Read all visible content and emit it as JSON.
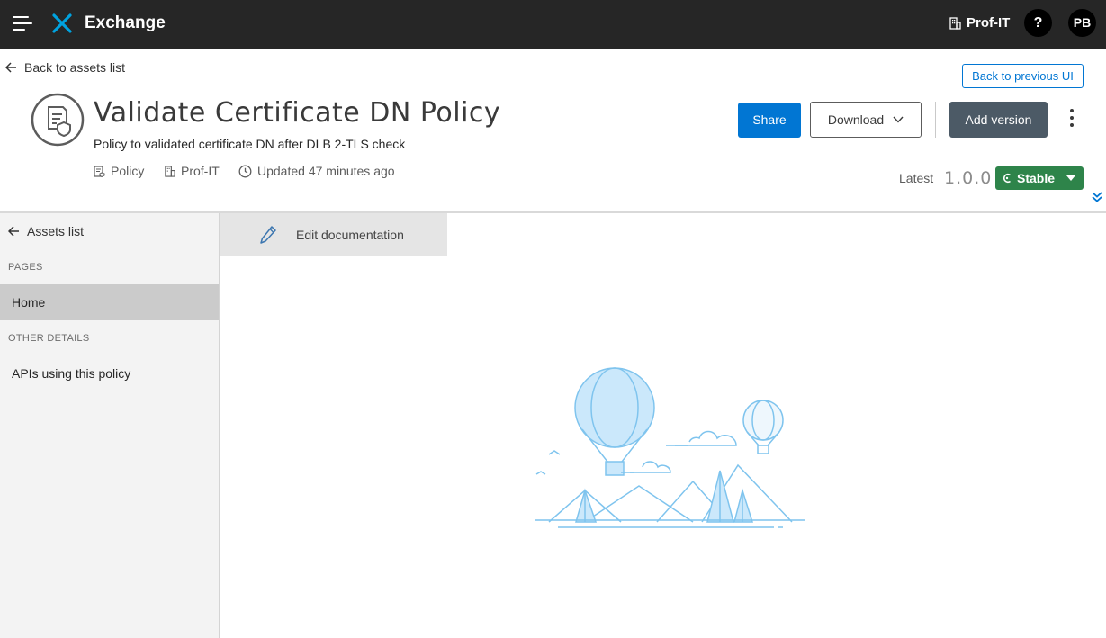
{
  "topbar": {
    "app_title": "Exchange",
    "org_name": "Prof-IT",
    "help_label": "?",
    "avatar_initials": "PB"
  },
  "header": {
    "back_link": "Back to assets list",
    "prev_ui_button": "Back to previous UI",
    "title": "Validate Certificate DN Policy",
    "description": "Policy to validated certificate DN after DLB 2-TLS check",
    "meta": {
      "type": "Policy",
      "org": "Prof-IT",
      "updated": "Updated 47 minutes ago"
    },
    "actions": {
      "share": "Share",
      "download": "Download",
      "add_version": "Add version"
    },
    "version": {
      "latest_label": "Latest",
      "number": "1.0.0",
      "status": "Stable",
      "status_color": "#2e844a"
    }
  },
  "sidebar": {
    "back": "Assets list",
    "pages_heading": "PAGES",
    "pages": [
      "Home"
    ],
    "other_heading": "OTHER DETAILS",
    "other_items": [
      "APIs using this policy"
    ]
  },
  "main": {
    "edit_doc": "Edit documentation"
  },
  "colors": {
    "primary": "#0176d3",
    "topbar": "#262626",
    "illustration": "#7fc4ee"
  }
}
